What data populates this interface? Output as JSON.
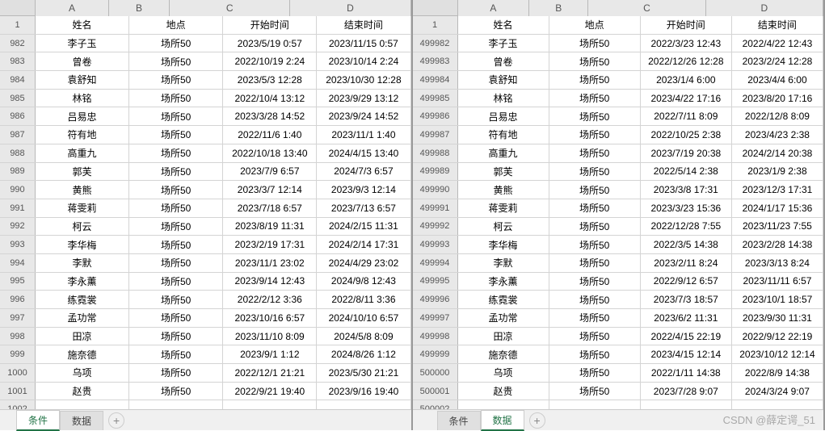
{
  "columns": [
    "A",
    "B",
    "C",
    "D"
  ],
  "headers": {
    "name": "姓名",
    "place": "地点",
    "start": "开始时间",
    "end": "结束时间"
  },
  "tabs": {
    "条件": "条件",
    "数据": "数据"
  },
  "add_label": "+",
  "watermark": "CSDN @薛定谔_51",
  "left": {
    "header_row": "1",
    "active_tab": "条件",
    "rows": [
      {
        "n": "982",
        "name": "李子玉",
        "place": "场所50",
        "start": "2023/5/19 0:57",
        "end": "2023/11/15 0:57"
      },
      {
        "n": "983",
        "name": "曾卷",
        "place": "场所50",
        "start": "2022/10/19 2:24",
        "end": "2023/10/14 2:24"
      },
      {
        "n": "984",
        "name": "袁舒知",
        "place": "场所50",
        "start": "2023/5/3 12:28",
        "end": "2023/10/30 12:28"
      },
      {
        "n": "985",
        "name": "林铭",
        "place": "场所50",
        "start": "2022/10/4 13:12",
        "end": "2023/9/29 13:12"
      },
      {
        "n": "986",
        "name": "吕易忠",
        "place": "场所50",
        "start": "2023/3/28 14:52",
        "end": "2023/9/24 14:52"
      },
      {
        "n": "987",
        "name": "符有地",
        "place": "场所50",
        "start": "2022/11/6 1:40",
        "end": "2023/11/1 1:40"
      },
      {
        "n": "988",
        "name": "高重九",
        "place": "场所50",
        "start": "2022/10/18 13:40",
        "end": "2024/4/15 13:40"
      },
      {
        "n": "989",
        "name": "郭芙",
        "place": "场所50",
        "start": "2023/7/9 6:57",
        "end": "2024/7/3 6:57"
      },
      {
        "n": "990",
        "name": "黄熊",
        "place": "场所50",
        "start": "2023/3/7 12:14",
        "end": "2023/9/3 12:14"
      },
      {
        "n": "991",
        "name": "蒋雯莉",
        "place": "场所50",
        "start": "2023/7/18 6:57",
        "end": "2023/7/13 6:57"
      },
      {
        "n": "992",
        "name": "柯云",
        "place": "场所50",
        "start": "2023/8/19 11:31",
        "end": "2024/2/15 11:31"
      },
      {
        "n": "993",
        "name": "李华梅",
        "place": "场所50",
        "start": "2023/2/19 17:31",
        "end": "2024/2/14 17:31"
      },
      {
        "n": "994",
        "name": "李默",
        "place": "场所50",
        "start": "2023/11/1 23:02",
        "end": "2024/4/29 23:02"
      },
      {
        "n": "995",
        "name": "李永薰",
        "place": "场所50",
        "start": "2023/9/14 12:43",
        "end": "2024/9/8 12:43"
      },
      {
        "n": "996",
        "name": "练霓裳",
        "place": "场所50",
        "start": "2022/2/12 3:36",
        "end": "2022/8/11 3:36"
      },
      {
        "n": "997",
        "name": "孟功常",
        "place": "场所50",
        "start": "2023/10/16 6:57",
        "end": "2024/10/10 6:57"
      },
      {
        "n": "998",
        "name": "田凉",
        "place": "场所50",
        "start": "2023/11/10 8:09",
        "end": "2024/5/8 8:09"
      },
      {
        "n": "999",
        "name": "施奈德",
        "place": "场所50",
        "start": "2023/9/1 1:12",
        "end": "2024/8/26 1:12"
      },
      {
        "n": "1000",
        "name": "乌项",
        "place": "场所50",
        "start": "2022/12/1 21:21",
        "end": "2023/5/30 21:21"
      },
      {
        "n": "1001",
        "name": "赵贵",
        "place": "场所50",
        "start": "2022/9/21 19:40",
        "end": "2023/9/16 19:40"
      },
      {
        "n": "1002",
        "name": "",
        "place": "",
        "start": "",
        "end": ""
      }
    ]
  },
  "right": {
    "header_row": "1",
    "active_tab": "数据",
    "rows": [
      {
        "n": "499982",
        "name": "李子玉",
        "place": "场所50",
        "start": "2022/3/23 12:43",
        "end": "2022/4/22 12:43"
      },
      {
        "n": "499983",
        "name": "曾卷",
        "place": "场所50",
        "start": "2022/12/26 12:28",
        "end": "2023/2/24 12:28"
      },
      {
        "n": "499984",
        "name": "袁舒知",
        "place": "场所50",
        "start": "2023/1/4 6:00",
        "end": "2023/4/4 6:00"
      },
      {
        "n": "499985",
        "name": "林铭",
        "place": "场所50",
        "start": "2023/4/22 17:16",
        "end": "2023/8/20 17:16"
      },
      {
        "n": "499986",
        "name": "吕易忠",
        "place": "场所50",
        "start": "2022/7/11 8:09",
        "end": "2022/12/8 8:09"
      },
      {
        "n": "499987",
        "name": "符有地",
        "place": "场所50",
        "start": "2022/10/25 2:38",
        "end": "2023/4/23 2:38"
      },
      {
        "n": "499988",
        "name": "高重九",
        "place": "场所50",
        "start": "2023/7/19 20:38",
        "end": "2024/2/14 20:38"
      },
      {
        "n": "499989",
        "name": "郭芙",
        "place": "场所50",
        "start": "2022/5/14 2:38",
        "end": "2023/1/9 2:38"
      },
      {
        "n": "499990",
        "name": "黄熊",
        "place": "场所50",
        "start": "2023/3/8 17:31",
        "end": "2023/12/3 17:31"
      },
      {
        "n": "499991",
        "name": "蒋雯莉",
        "place": "场所50",
        "start": "2023/3/23 15:36",
        "end": "2024/1/17 15:36"
      },
      {
        "n": "499992",
        "name": "柯云",
        "place": "场所50",
        "start": "2022/12/28 7:55",
        "end": "2023/11/23 7:55"
      },
      {
        "n": "499993",
        "name": "李华梅",
        "place": "场所50",
        "start": "2022/3/5 14:38",
        "end": "2023/2/28 14:38"
      },
      {
        "n": "499994",
        "name": "李默",
        "place": "场所50",
        "start": "2023/2/11 8:24",
        "end": "2023/3/13 8:24"
      },
      {
        "n": "499995",
        "name": "李永薰",
        "place": "场所50",
        "start": "2022/9/12 6:57",
        "end": "2023/11/11 6:57"
      },
      {
        "n": "499996",
        "name": "练霓裳",
        "place": "场所50",
        "start": "2023/7/3 18:57",
        "end": "2023/10/1 18:57"
      },
      {
        "n": "499997",
        "name": "孟功常",
        "place": "场所50",
        "start": "2023/6/2 11:31",
        "end": "2023/9/30 11:31"
      },
      {
        "n": "499998",
        "name": "田凉",
        "place": "场所50",
        "start": "2022/4/15 22:19",
        "end": "2022/9/12 22:19"
      },
      {
        "n": "499999",
        "name": "施奈德",
        "place": "场所50",
        "start": "2023/4/15 12:14",
        "end": "2023/10/12 12:14"
      },
      {
        "n": "500000",
        "name": "乌项",
        "place": "场所50",
        "start": "2022/1/11 14:38",
        "end": "2022/8/9 14:38"
      },
      {
        "n": "500001",
        "name": "赵贵",
        "place": "场所50",
        "start": "2023/7/28 9:07",
        "end": "2024/3/24 9:07"
      },
      {
        "n": "500002",
        "name": "",
        "place": "",
        "start": "",
        "end": ""
      }
    ]
  }
}
